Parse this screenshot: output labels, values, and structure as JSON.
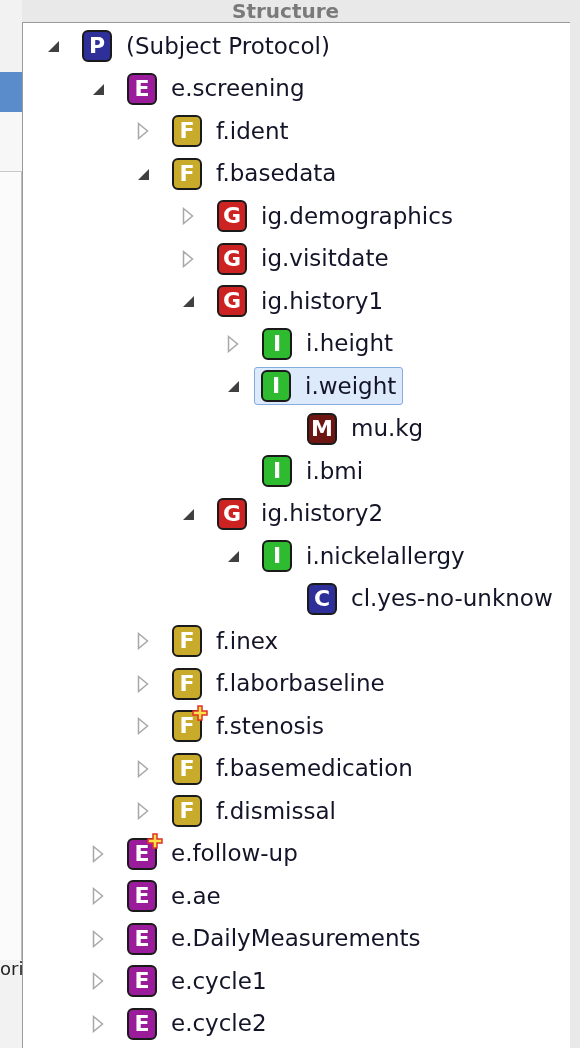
{
  "heading": "Structure",
  "background_window": {
    "text": "ori"
  },
  "tree": [
    {
      "label": "(Subject Protocol)",
      "badge": "P",
      "kind": "protocol",
      "expanded": true,
      "selected": false,
      "added": false,
      "children": [
        {
          "label": "e.screening",
          "badge": "E",
          "kind": "event",
          "expanded": true,
          "selected": false,
          "added": false,
          "children": [
            {
              "label": "f.ident",
              "badge": "F",
              "kind": "form",
              "expanded": false,
              "selected": false,
              "added": false
            },
            {
              "label": "f.basedata",
              "badge": "F",
              "kind": "form",
              "expanded": true,
              "selected": false,
              "added": false,
              "children": [
                {
                  "label": "ig.demographics",
                  "badge": "G",
                  "kind": "group",
                  "expanded": false,
                  "selected": false,
                  "added": false
                },
                {
                  "label": "ig.visitdate",
                  "badge": "G",
                  "kind": "group",
                  "expanded": false,
                  "selected": false,
                  "added": false
                },
                {
                  "label": "ig.history1",
                  "badge": "G",
                  "kind": "group",
                  "expanded": true,
                  "selected": false,
                  "added": false,
                  "children": [
                    {
                      "label": "i.height",
                      "badge": "I",
                      "kind": "item",
                      "expanded": false,
                      "selected": false,
                      "added": false
                    },
                    {
                      "label": "i.weight",
                      "badge": "I",
                      "kind": "item",
                      "expanded": true,
                      "selected": true,
                      "added": false,
                      "children": [
                        {
                          "label": "mu.kg",
                          "badge": "M",
                          "kind": "unit",
                          "selected": false,
                          "added": false
                        }
                      ]
                    },
                    {
                      "label": "i.bmi",
                      "badge": "I",
                      "kind": "item",
                      "selected": false,
                      "added": false
                    }
                  ]
                },
                {
                  "label": "ig.history2",
                  "badge": "G",
                  "kind": "group",
                  "expanded": true,
                  "selected": false,
                  "added": false,
                  "children": [
                    {
                      "label": "i.nickelallergy",
                      "badge": "I",
                      "kind": "item",
                      "expanded": true,
                      "selected": false,
                      "added": false,
                      "children": [
                        {
                          "label": "cl.yes-no-unknow",
                          "badge": "C",
                          "kind": "codelist",
                          "selected": false,
                          "added": false
                        }
                      ]
                    }
                  ]
                }
              ]
            },
            {
              "label": "f.inex",
              "badge": "F",
              "kind": "form",
              "expanded": false,
              "selected": false,
              "added": false
            },
            {
              "label": "f.laborbaseline",
              "badge": "F",
              "kind": "form",
              "expanded": false,
              "selected": false,
              "added": false
            },
            {
              "label": "f.stenosis",
              "badge": "F",
              "kind": "form",
              "expanded": false,
              "selected": false,
              "added": true
            },
            {
              "label": "f.basemedication",
              "badge": "F",
              "kind": "form",
              "expanded": false,
              "selected": false,
              "added": false
            },
            {
              "label": "f.dismissal",
              "badge": "F",
              "kind": "form",
              "expanded": false,
              "selected": false,
              "added": false
            }
          ]
        },
        {
          "label": "e.follow-up",
          "badge": "E",
          "kind": "event",
          "expanded": false,
          "selected": false,
          "added": true
        },
        {
          "label": "e.ae",
          "badge": "E",
          "kind": "event",
          "expanded": false,
          "selected": false,
          "added": false
        },
        {
          "label": "e.DailyMeasurements",
          "badge": "E",
          "kind": "event",
          "expanded": false,
          "selected": false,
          "added": false
        },
        {
          "label": "e.cycle1",
          "badge": "E",
          "kind": "event",
          "expanded": false,
          "selected": false,
          "added": false
        },
        {
          "label": "e.cycle2",
          "badge": "E",
          "kind": "event",
          "expanded": false,
          "selected": false,
          "added": false
        }
      ]
    }
  ]
}
